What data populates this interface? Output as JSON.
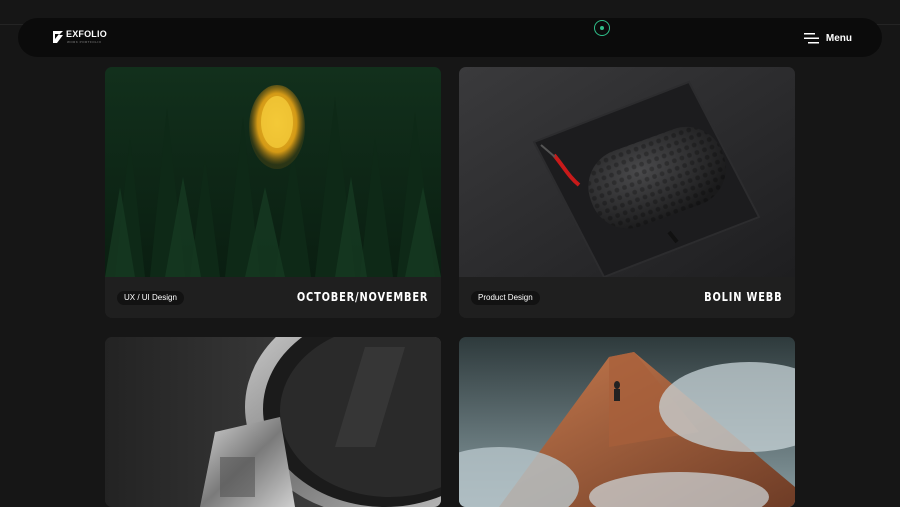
{
  "brand": {
    "name": "EXFOLIO",
    "tagline": "WORK PORTFOLIO"
  },
  "nav": {
    "menu_label": "Menu"
  },
  "projects": [
    {
      "category": "UX / UI Design",
      "title": "OCTOBER/NOVEMBER",
      "image": "forest-yellow-tree"
    },
    {
      "category": "Product Design",
      "title": "BOLIN WEBB",
      "image": "black-product-case"
    },
    {
      "category": "",
      "title": "",
      "image": "smartwatch-closeup"
    },
    {
      "category": "",
      "title": "",
      "image": "mountain-hiker-mist"
    }
  ],
  "colors": {
    "background": "#161616",
    "nav": "#0b0b0b",
    "accent": "#2fbf8a"
  }
}
